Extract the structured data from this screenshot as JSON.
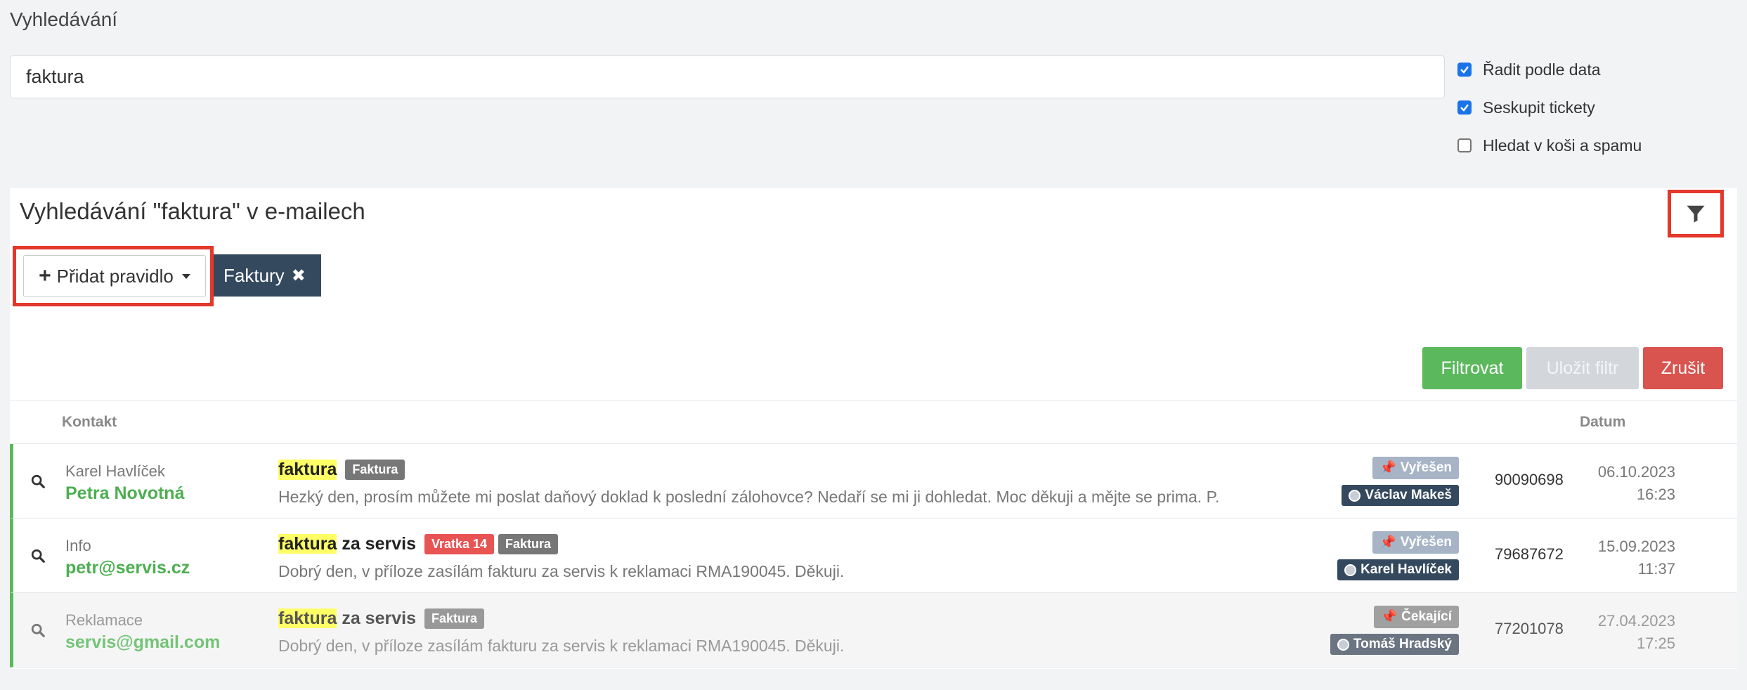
{
  "page": {
    "title": "Vyhledávání"
  },
  "search": {
    "value": "faktura"
  },
  "options": [
    {
      "label": "Řadit podle data",
      "checked": true
    },
    {
      "label": "Seskupit tickety",
      "checked": true
    },
    {
      "label": "Hledat v koši a spamu",
      "checked": false
    }
  ],
  "panel": {
    "title": "Vyhledávání \"faktura\" v e-mailech"
  },
  "rules": {
    "add_label": "Přidat pravidlo",
    "active_tag": "Faktury"
  },
  "actions": {
    "filter": "Filtrovat",
    "save": "Uložit filtr",
    "cancel": "Zrušit"
  },
  "table": {
    "headers": {
      "contact": "Kontakt",
      "date": "Datum"
    },
    "rows": [
      {
        "sender": "Karel Havlíček",
        "contact": "Petra Novotná",
        "subject_highlight": "faktura",
        "subject_rest": "",
        "labels": [
          "Faktura"
        ],
        "preview": "Hezký den, prosím můžete mi poslat daňový doklad k poslední zálohovce? Nedaří se mi ji dohledat. Moc děkuji a mějte se prima. P.",
        "status": "Vyřešen",
        "agent": "Václav Makeš",
        "ticket": "90090698",
        "date": "06.10.2023",
        "time": "16:23"
      },
      {
        "sender": "Info",
        "contact": "petr@servis.cz",
        "subject_highlight": "faktura",
        "subject_rest": "za servis",
        "labels_red": [
          "Vratka 14"
        ],
        "labels": [
          "Faktura"
        ],
        "preview": "Dobrý den, v příloze zasílám fakturu za servis k reklamaci RMA190045. Děkuji.",
        "status": "Vyřešen",
        "agent": "Karel Havlíček",
        "ticket": "79687672",
        "date": "15.09.2023",
        "time": "11:37"
      },
      {
        "sender": "Reklamace",
        "contact": "servis@gmail.com",
        "subject_highlight": "faktura",
        "subject_rest": "za servis",
        "labels": [
          "Faktura"
        ],
        "preview": "Dobrý den, v příloze zasílám fakturu za servis k reklamaci RMA190045. Děkuji.",
        "status": "Čekající",
        "agent": "Tomáš Hradský",
        "ticket": "77201078",
        "date": "27.04.2023",
        "time": "17:25"
      }
    ]
  },
  "icons": {
    "filter": "filter-funnel-icon",
    "search": "magnifier-icon",
    "pin": "pin-icon",
    "plus": "plus-icon",
    "close": "close-icon"
  },
  "colors": {
    "highlight": "#e3382b",
    "success": "#5cb85c",
    "danger": "#d9534f",
    "tag": "#34495e"
  }
}
